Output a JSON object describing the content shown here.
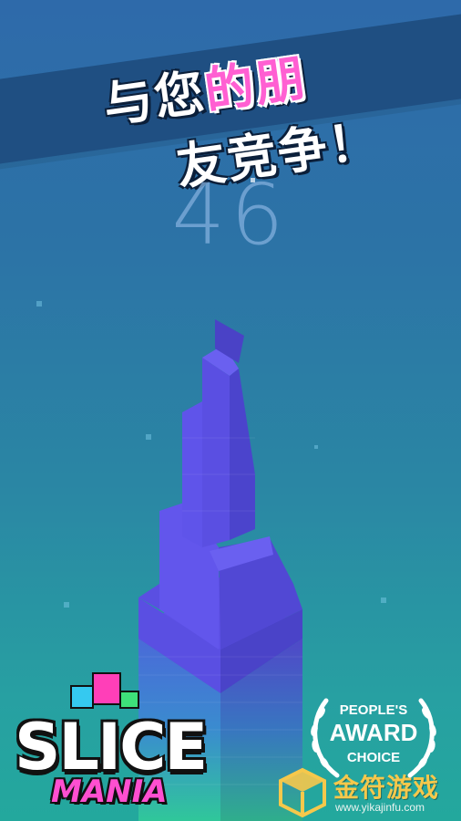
{
  "promo": {
    "line1_normal": "与您",
    "line1_highlight": "的朋",
    "line2": "友竞争！"
  },
  "hud": {
    "score": "46"
  },
  "logo": {
    "word1": "SLICE",
    "word2": "MANIA"
  },
  "award": {
    "line1": "PEOPLE'S",
    "line2": "AWARD",
    "line3": "CHOICE"
  },
  "watermark": {
    "title": "金符游戏",
    "url": "www.yikajinfu.com"
  },
  "colors": {
    "background_top": "#2e6aaa",
    "background_bottom": "#23a89d",
    "tower_purple": "#5b4fe0",
    "highlight_pink": "#ff5fd2",
    "watermark_gold": "#f6c84b"
  }
}
